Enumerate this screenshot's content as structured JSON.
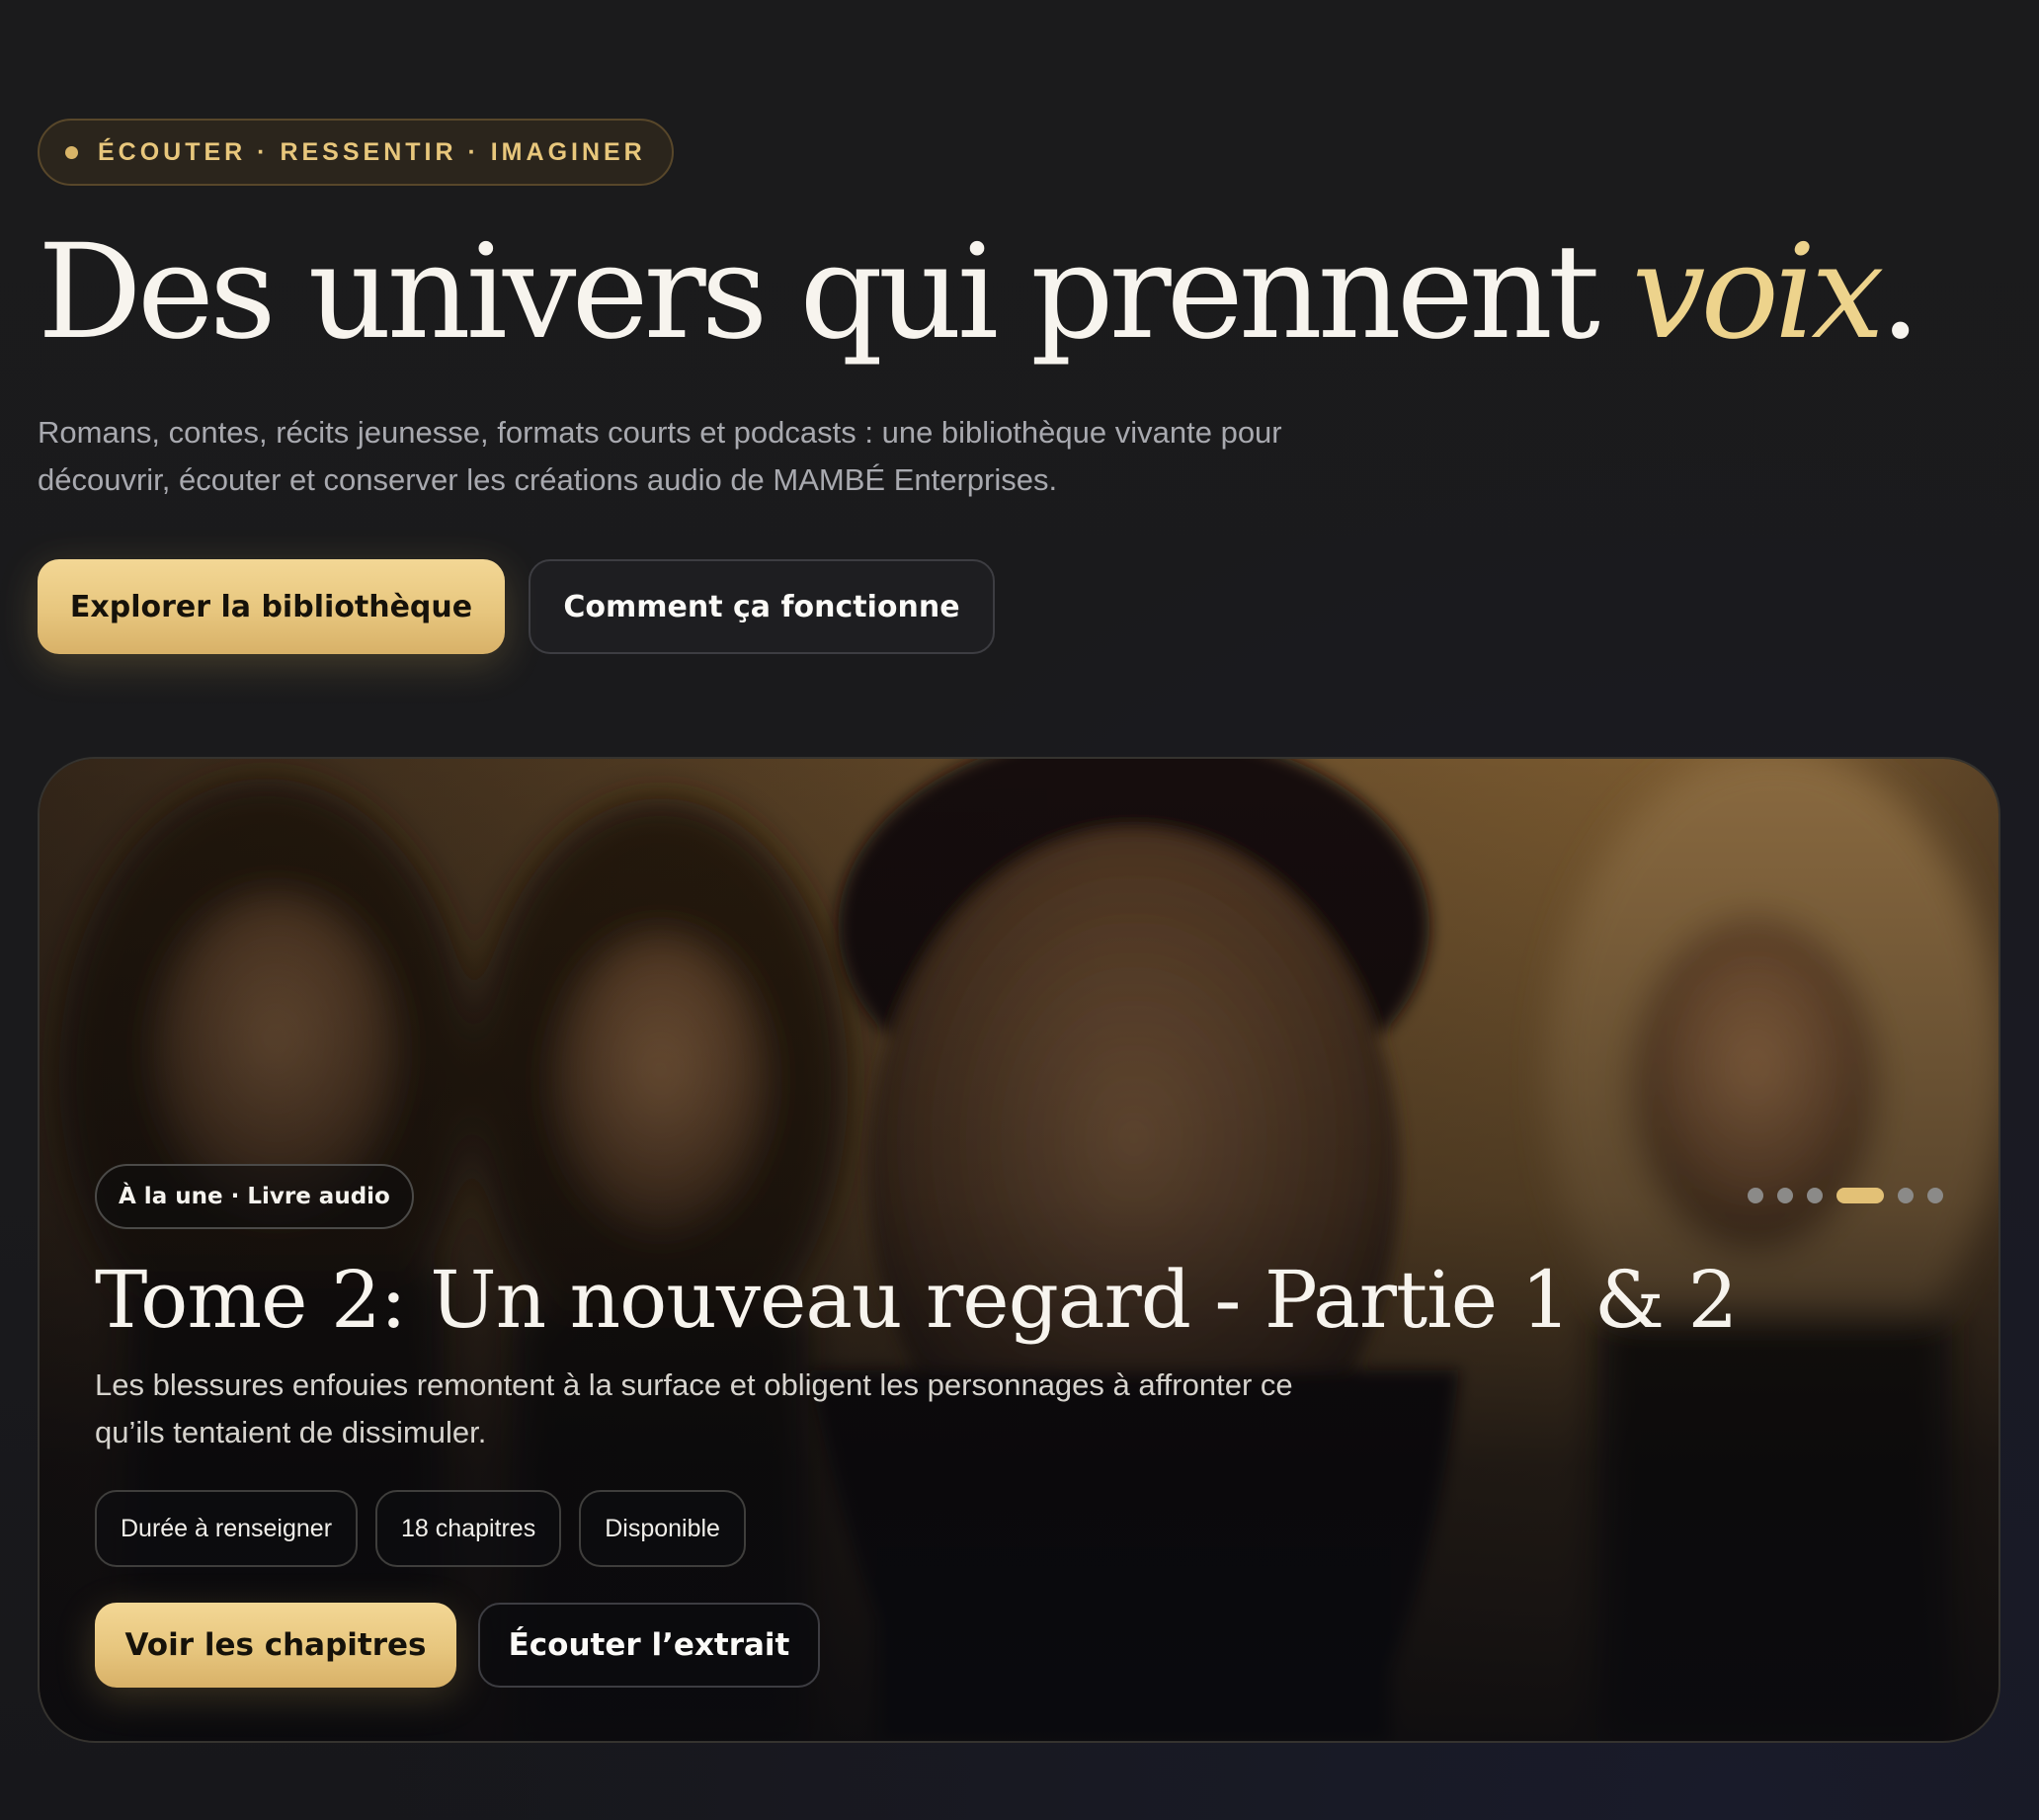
{
  "hero": {
    "eyebrow": "ÉCOUTER · RESSENTIR · IMAGINER",
    "title_main": "Des univers qui prennent ",
    "title_accent": "voix",
    "title_end": ".",
    "subtitle": "Romans, contes, récits jeunesse, formats courts et podcasts : une bibliothèque vivante pour découvrir, écouter et conserver les créations audio de MAMBÉ Enterprises.",
    "buttons": {
      "explore": "Explorer la bibliothèque",
      "how_it_works": "Comment ça fonctionne"
    }
  },
  "featured": {
    "tag": "À la une · Livre audio",
    "title": "Tome 2: Un nouveau regard - Partie 1 & 2",
    "description": "Les blessures enfouies remontent à la surface et obligent les personnages à affronter ce qu’ils tentaient de dissimuler.",
    "chips": [
      "Durée à renseigner",
      "18 chapitres",
      "Disponible"
    ],
    "buttons": {
      "chapters": "Voir les chapitres",
      "extract": "Écouter l’extrait"
    },
    "carousel": {
      "total_slides": 6,
      "active_slide": 4
    },
    "image": "cover-art-four-people"
  },
  "colors": {
    "accent_gold": "#e7c67e",
    "title_accent": "#edd38c",
    "background": "#1b1b1c"
  }
}
